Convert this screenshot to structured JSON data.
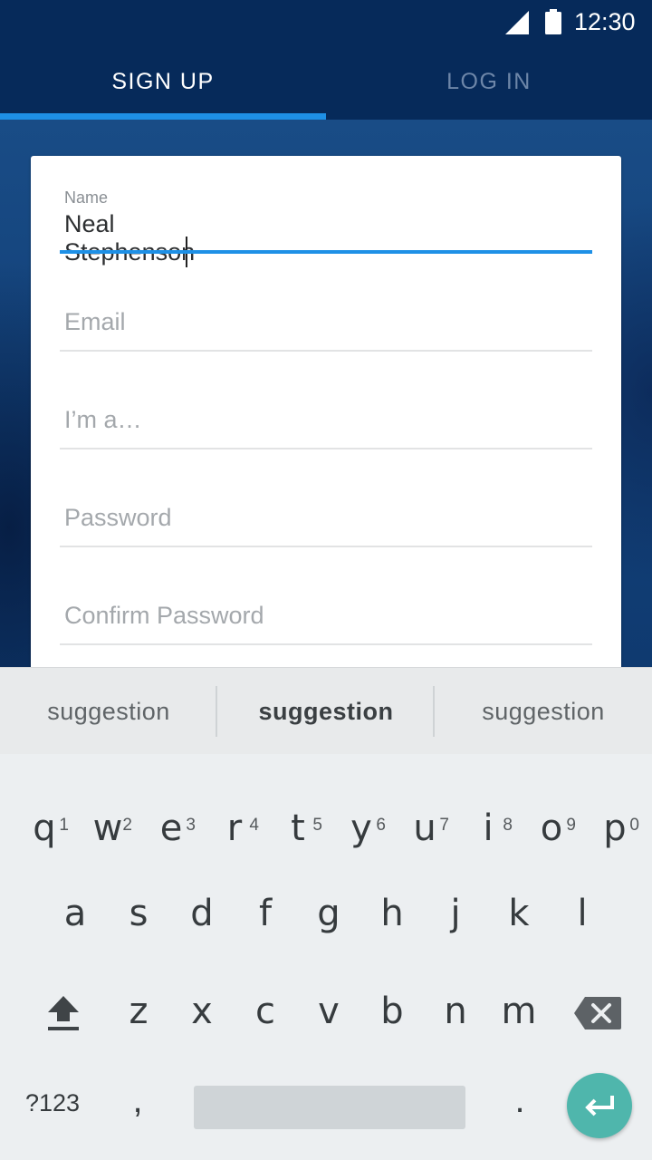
{
  "status_bar": {
    "time": "12:30",
    "signal_icon": "cell-signal-icon",
    "battery_icon": "battery-full-icon"
  },
  "tabs": [
    {
      "label": "SIGN UP",
      "selected": true
    },
    {
      "label": "LOG IN",
      "selected": false
    }
  ],
  "form": {
    "name": {
      "label": "Name",
      "value": "Neal Stephenson",
      "focused": true
    },
    "email": {
      "placeholder": "Email"
    },
    "role": {
      "placeholder": "I’m a…"
    },
    "password": {
      "placeholder": "Password"
    },
    "confirm_password": {
      "placeholder": "Confirm Password"
    }
  },
  "keyboard": {
    "suggestions": [
      "suggestion",
      "suggestion",
      "suggestion"
    ],
    "row1": [
      {
        "key": "q",
        "hint": "1"
      },
      {
        "key": "w",
        "hint": "2"
      },
      {
        "key": "e",
        "hint": "3"
      },
      {
        "key": "r",
        "hint": "4"
      },
      {
        "key": "t",
        "hint": "5"
      },
      {
        "key": "y",
        "hint": "6"
      },
      {
        "key": "u",
        "hint": "7"
      },
      {
        "key": "i",
        "hint": "8"
      },
      {
        "key": "o",
        "hint": "9"
      },
      {
        "key": "p",
        "hint": "0"
      }
    ],
    "row2": [
      "a",
      "s",
      "d",
      "f",
      "g",
      "h",
      "j",
      "k",
      "l"
    ],
    "row3": [
      "z",
      "x",
      "c",
      "v",
      "b",
      "n",
      "m"
    ],
    "symbols_label": "?123",
    "comma_label": ",",
    "period_label": ".",
    "shift_icon": "shift-icon",
    "backspace_icon": "backspace-icon",
    "enter_icon": "enter-icon",
    "enter_color": "#4fb6ac"
  },
  "colors": {
    "accent": "#1e90e6",
    "header": "#062a5a"
  }
}
